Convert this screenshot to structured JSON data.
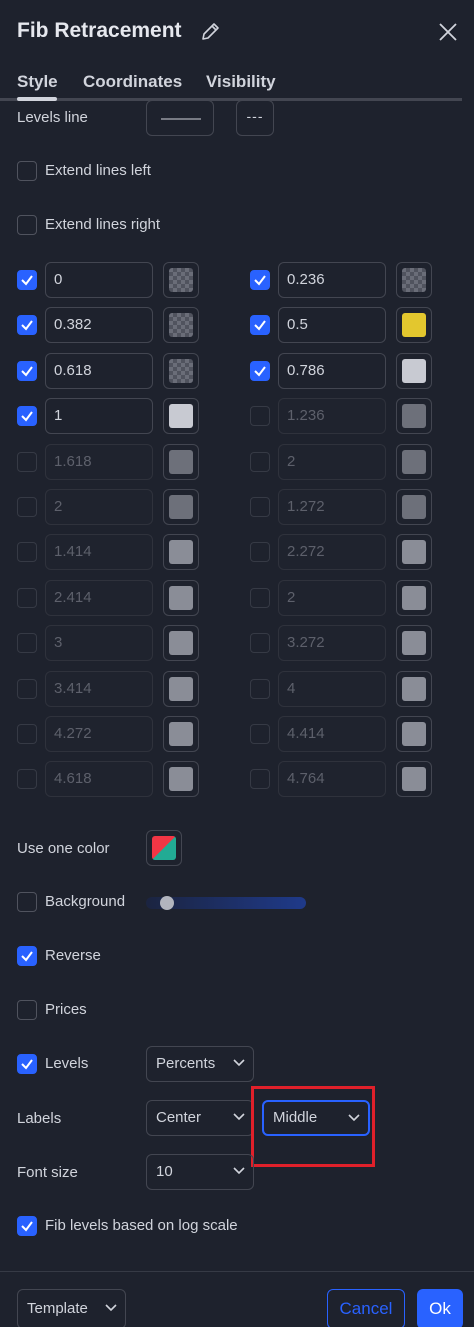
{
  "dialog": {
    "title": "Fib Retracement",
    "edit_icon": "pencil-icon",
    "close_icon": "close-icon"
  },
  "tabs": [
    {
      "label": "Style",
      "active": true
    },
    {
      "label": "Coordinates",
      "active": false
    },
    {
      "label": "Visibility",
      "active": false
    }
  ],
  "style": {
    "levels_line_label": "Levels line",
    "levels_line_style": "---",
    "extend_left_label": "Extend lines left",
    "extend_left_checked": false,
    "extend_right_label": "Extend lines right",
    "extend_right_checked": false,
    "levels": [
      {
        "value": "0",
        "checked": true,
        "color": "checker"
      },
      {
        "value": "0.236",
        "checked": true,
        "color": "checker"
      },
      {
        "value": "0.382",
        "checked": true,
        "color": "checker"
      },
      {
        "value": "0.5",
        "checked": true,
        "color": "#e3c72e"
      },
      {
        "value": "0.618",
        "checked": true,
        "color": "checker"
      },
      {
        "value": "0.786",
        "checked": true,
        "color": "#c8cad2"
      },
      {
        "value": "1",
        "checked": true,
        "color": "#c8cad2"
      },
      {
        "value": "1.236",
        "checked": false,
        "color": "#6d707a"
      },
      {
        "value": "1.618",
        "checked": false,
        "color": "#6d707a"
      },
      {
        "value": "2",
        "checked": false,
        "color": "#6d707a"
      },
      {
        "value": "2",
        "checked": false,
        "color": "#6d707a"
      },
      {
        "value": "1.272",
        "checked": false,
        "color": "#6d707a"
      },
      {
        "value": "1.414",
        "checked": false,
        "color": "#8a8d97"
      },
      {
        "value": "2.272",
        "checked": false,
        "color": "#8a8d97"
      },
      {
        "value": "2.414",
        "checked": false,
        "color": "#8a8d97"
      },
      {
        "value": "2",
        "checked": false,
        "color": "#8a8d97"
      },
      {
        "value": "3",
        "checked": false,
        "color": "#8a8d97"
      },
      {
        "value": "3.272",
        "checked": false,
        "color": "#8a8d97"
      },
      {
        "value": "3.414",
        "checked": false,
        "color": "#8a8d97"
      },
      {
        "value": "4",
        "checked": false,
        "color": "#8a8d97"
      },
      {
        "value": "4.272",
        "checked": false,
        "color": "#8a8d97"
      },
      {
        "value": "4.414",
        "checked": false,
        "color": "#8a8d97"
      },
      {
        "value": "4.618",
        "checked": false,
        "color": "#8a8d97"
      },
      {
        "value": "4.764",
        "checked": false,
        "color": "#8a8d97"
      }
    ],
    "use_one_color_label": "Use one color",
    "background_label": "Background",
    "background_checked": false,
    "background_opacity": 0.1,
    "reverse_label": "Reverse",
    "reverse_checked": true,
    "prices_label": "Prices",
    "prices_checked": false,
    "levels_label": "Levels",
    "levels_checked": true,
    "levels_format": "Percents",
    "labels_label": "Labels",
    "labels_horizontal": "Center",
    "labels_vertical": "Middle",
    "font_size_label": "Font size",
    "font_size": "10",
    "log_scale_label": "Fib levels based on log scale",
    "log_scale_checked": true
  },
  "footer": {
    "template_label": "Template",
    "cancel_label": "Cancel",
    "ok_label": "Ok"
  },
  "colors": {
    "background": "#1e222d",
    "accent": "#2962ff",
    "highlight_frame": "#e0202a"
  }
}
